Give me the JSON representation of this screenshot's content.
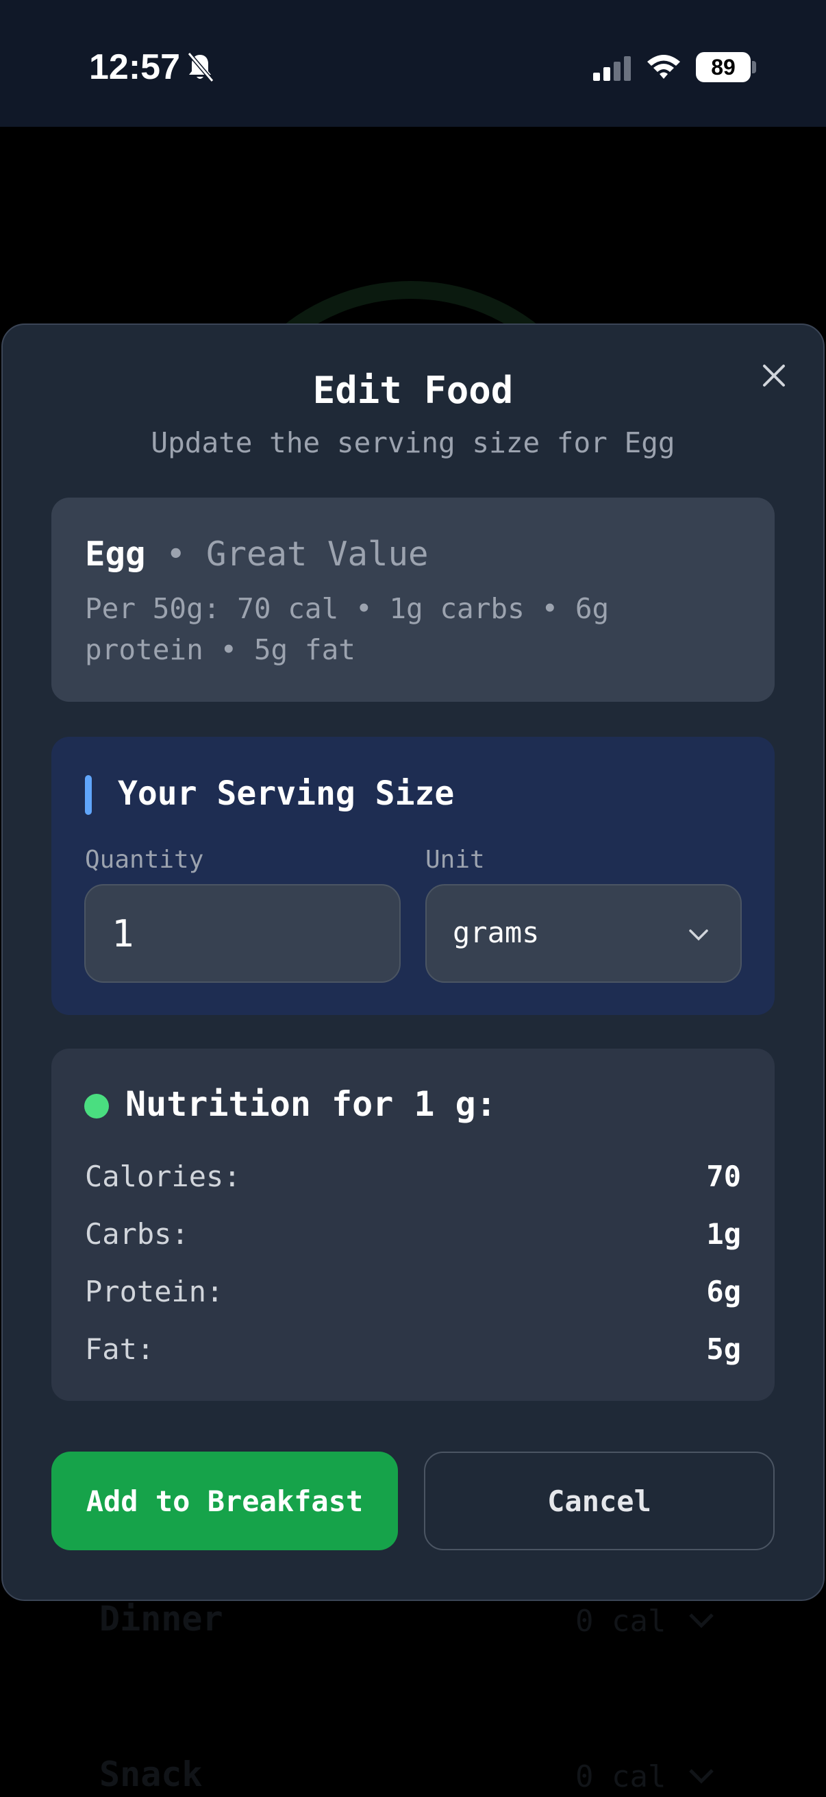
{
  "status_bar": {
    "time": "12:57",
    "battery": "89",
    "icons": [
      "bell-slash-icon",
      "signal-icon",
      "wifi-icon",
      "battery-icon"
    ]
  },
  "background": {
    "meals": [
      {
        "name": "Dinner",
        "calories": "0 cal"
      },
      {
        "name": "Snack",
        "calories": "0 cal"
      }
    ]
  },
  "modal": {
    "title": "Edit Food",
    "subtitle": "Update the serving size for Egg",
    "close_icon": "close-icon",
    "food": {
      "name": "Egg",
      "separator": " • ",
      "brand": "Great Value",
      "per_serving": "Per 50g: 70 cal • 1g carbs • 6g protein • 5g fat"
    },
    "serving": {
      "title": "Your Serving Size",
      "quantity_label": "Quantity",
      "quantity_value": "1",
      "unit_label": "Unit",
      "unit_value": "grams"
    },
    "nutrition": {
      "title": "Nutrition for 1 g:",
      "rows": [
        {
          "label": "Calories:",
          "value": "70"
        },
        {
          "label": "Carbs:",
          "value": "1g"
        },
        {
          "label": "Protein:",
          "value": "6g"
        },
        {
          "label": "Fat:",
          "value": "5g"
        }
      ]
    },
    "buttons": {
      "add": "Add to Breakfast",
      "cancel": "Cancel"
    }
  },
  "colors": {
    "primary_green": "#16a34a",
    "accent_blue": "#60a5fa",
    "status_green": "#4ade80",
    "modal_bg": "#1f2937"
  }
}
